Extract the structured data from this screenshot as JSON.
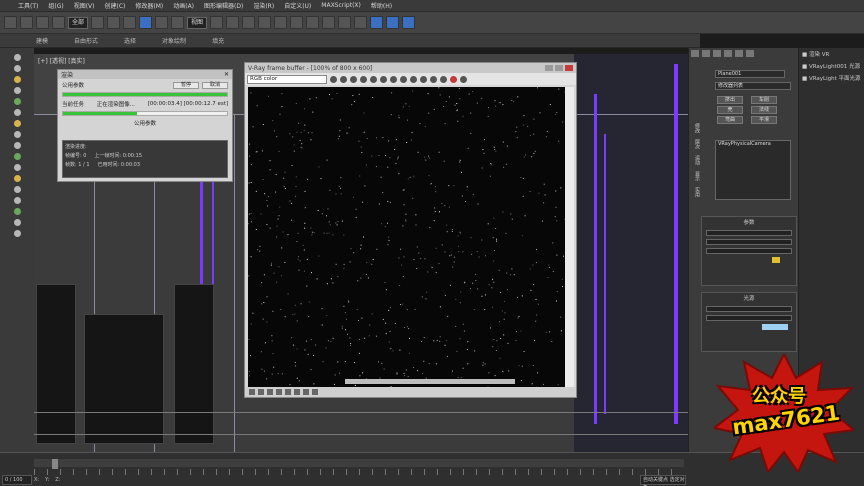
{
  "menubar": [
    "工具(T)",
    "组(G)",
    "视图(V)",
    "创建(C)",
    "修改器(M)",
    "动画(A)",
    "图形编辑器(D)",
    "渲染(R)",
    "自定义(U)",
    "MAXScript(X)",
    "帮助(H)"
  ],
  "toolbar": {
    "selection_filter": "全部",
    "view_dropdown": "视图"
  },
  "ribbon": [
    "建模",
    "自由形式",
    "选择",
    "对象绘制",
    "填充"
  ],
  "viewport": {
    "label": "[+] [透视] [真实]"
  },
  "render_window": {
    "title": "V-Ray frame buffer - [100% of 800 x 600]",
    "channel": "RGB color"
  },
  "progress_window": {
    "title": "渲染",
    "row1_label": "公用参数",
    "btn_pause": "暂停",
    "btn_cancel": "取消",
    "row2_label": "当前任务",
    "row2_value": "正在渲染图像...",
    "row2_time": "[00:00:03.4] [00:00:12.7 est]",
    "row3_label": "公用参数",
    "dark_lines": [
      "渲染进度:",
      "帧编号: 0",
      "上一帧时间: 0:00:15",
      "已用时间: 0:00:03",
      "帧数: 1 / 1"
    ],
    "progress_top_pct": 100,
    "progress_bottom_pct": 45
  },
  "command_panel": {
    "object_name": "Plane001",
    "modifier_list": "修改器列表",
    "buttons": [
      "挤出",
      "车削",
      "壳",
      "法线",
      "弯曲",
      "平滑"
    ],
    "stack_item": "VRayPhysicalCamera",
    "vertical_labels": [
      "修改",
      "层次",
      "运动",
      "显示",
      "实用"
    ],
    "section_title": "参数",
    "section2_title": "光源"
  },
  "right_panel": {
    "items": [
      "■ 渲染 VR",
      "■ VRayLight001 光源",
      "■ VRayLight 平面光源"
    ]
  },
  "timeline": {
    "frame": "0 / 100",
    "coords": [
      "X:",
      "Y:",
      "Z:"
    ],
    "status_right": "自动关键点 选定对象"
  },
  "watermark": {
    "line1": "公众号",
    "line2": "max7621"
  },
  "colors": {
    "accent_blue": "#3a6fc4",
    "progress_green": "#38c438",
    "wire_purple": "#7b3bff",
    "watermark_yellow": "#ffd400"
  }
}
